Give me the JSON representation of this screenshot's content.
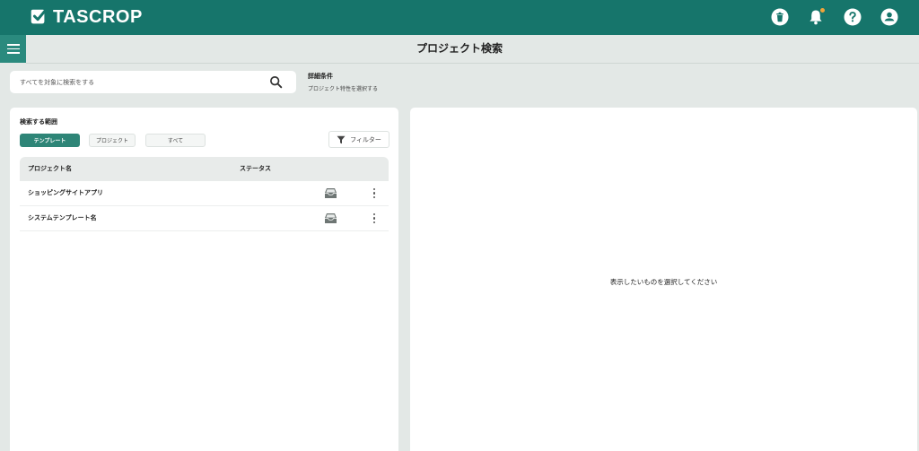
{
  "header": {
    "logo_text": "TASCROP",
    "brand_color": "#16756b",
    "icons": [
      "trash-icon",
      "bell-icon",
      "help-icon",
      "user-icon"
    ],
    "notification_dot_color": "#f0a43a"
  },
  "page": {
    "title": "プロジェクト検索"
  },
  "search": {
    "placeholder": "すべてを対象に検索をする",
    "value": ""
  },
  "advanced": {
    "title": "詳細条件",
    "subtitle": "プロジェクト特性を選択する"
  },
  "scope": {
    "label": "検索する範囲",
    "chips": [
      {
        "label": "テンプレート",
        "active": true
      },
      {
        "label": "プロジェクト",
        "active": false
      },
      {
        "label": "すべて",
        "active": false
      }
    ]
  },
  "filter": {
    "label": "フィルター"
  },
  "table": {
    "columns": [
      "プロジェクト名",
      "ステータス"
    ],
    "rows": [
      {
        "name": "ショッピングサイトアプリ",
        "status_icon": "inbox-icon"
      },
      {
        "name": "システムテンプレート名",
        "status_icon": "inbox-icon"
      }
    ]
  },
  "detail": {
    "empty_message": "表示したいものを選択してください"
  }
}
